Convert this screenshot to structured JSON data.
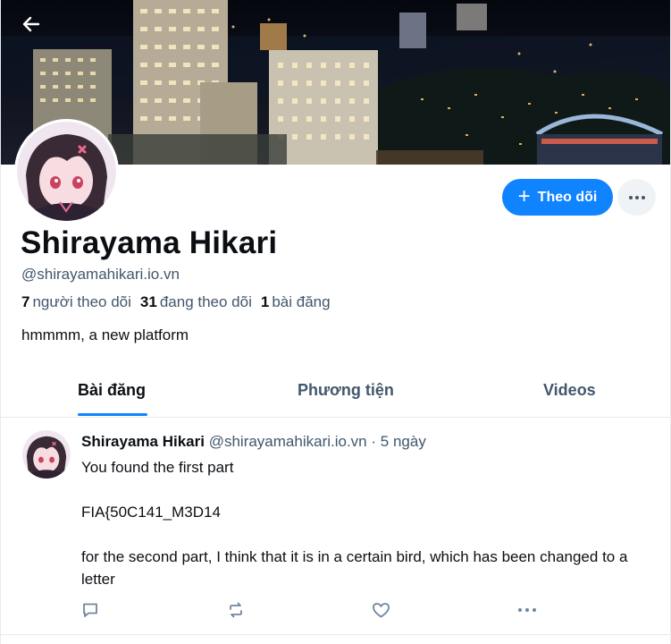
{
  "profile": {
    "display_name": "Shirayama Hikari",
    "handle": "@shirayamahikari.io.vn",
    "followers_count": "7",
    "followers_label": "người theo dõi",
    "following_count": "31",
    "following_label": "đang theo dõi",
    "posts_count": "1",
    "posts_label": "bài đăng",
    "bio": "hmmmm, a new platform"
  },
  "actions": {
    "follow_label": "Theo dõi"
  },
  "tabs": [
    {
      "label": "Bài đăng",
      "active": true
    },
    {
      "label": "Phương tiện",
      "active": false
    },
    {
      "label": "Videos",
      "active": false
    }
  ],
  "post": {
    "author": "Shirayama Hikari",
    "handle": "@shirayamahikari.io.vn",
    "separator": "·",
    "time": "5 ngày",
    "lines": [
      "You found the first part",
      "FIA{50C141_M3D14",
      "for the second part, I think that it is in a certain bird, which has been changed to a letter"
    ]
  },
  "icons": {
    "back": "arrow-left-icon",
    "plus": "plus-icon",
    "more": "more-horizontal-icon",
    "reply": "reply-icon",
    "repost": "repost-icon",
    "like": "heart-icon",
    "post_more": "more-horizontal-icon"
  },
  "colors": {
    "accent": "#1083fe",
    "text_primary": "#0b0f14",
    "text_secondary": "#42576c",
    "divider": "#e6eaee"
  }
}
